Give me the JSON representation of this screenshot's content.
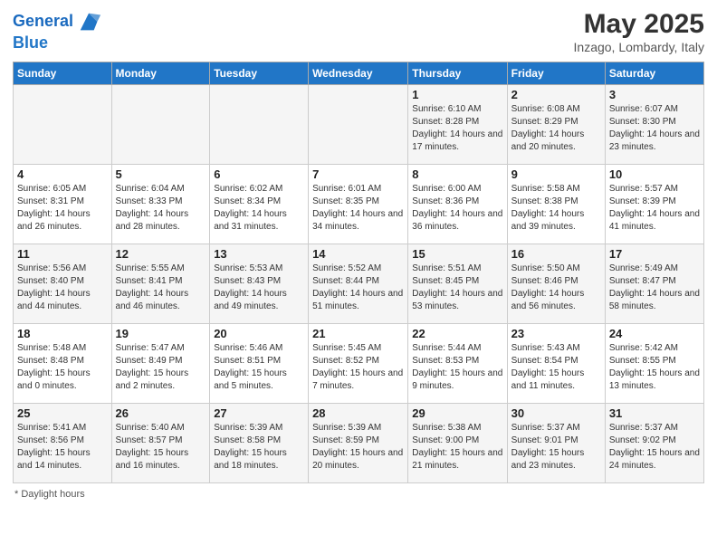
{
  "header": {
    "logo_line1": "General",
    "logo_line2": "Blue",
    "main_title": "May 2025",
    "subtitle": "Inzago, Lombardy, Italy"
  },
  "weekdays": [
    "Sunday",
    "Monday",
    "Tuesday",
    "Wednesday",
    "Thursday",
    "Friday",
    "Saturday"
  ],
  "weeks": [
    [
      {
        "day": "",
        "sunrise": "",
        "sunset": "",
        "daylight": ""
      },
      {
        "day": "",
        "sunrise": "",
        "sunset": "",
        "daylight": ""
      },
      {
        "day": "",
        "sunrise": "",
        "sunset": "",
        "daylight": ""
      },
      {
        "day": "",
        "sunrise": "",
        "sunset": "",
        "daylight": ""
      },
      {
        "day": "1",
        "sunrise": "Sunrise: 6:10 AM",
        "sunset": "Sunset: 8:28 PM",
        "daylight": "Daylight: 14 hours and 17 minutes."
      },
      {
        "day": "2",
        "sunrise": "Sunrise: 6:08 AM",
        "sunset": "Sunset: 8:29 PM",
        "daylight": "Daylight: 14 hours and 20 minutes."
      },
      {
        "day": "3",
        "sunrise": "Sunrise: 6:07 AM",
        "sunset": "Sunset: 8:30 PM",
        "daylight": "Daylight: 14 hours and 23 minutes."
      }
    ],
    [
      {
        "day": "4",
        "sunrise": "Sunrise: 6:05 AM",
        "sunset": "Sunset: 8:31 PM",
        "daylight": "Daylight: 14 hours and 26 minutes."
      },
      {
        "day": "5",
        "sunrise": "Sunrise: 6:04 AM",
        "sunset": "Sunset: 8:33 PM",
        "daylight": "Daylight: 14 hours and 28 minutes."
      },
      {
        "day": "6",
        "sunrise": "Sunrise: 6:02 AM",
        "sunset": "Sunset: 8:34 PM",
        "daylight": "Daylight: 14 hours and 31 minutes."
      },
      {
        "day": "7",
        "sunrise": "Sunrise: 6:01 AM",
        "sunset": "Sunset: 8:35 PM",
        "daylight": "Daylight: 14 hours and 34 minutes."
      },
      {
        "day": "8",
        "sunrise": "Sunrise: 6:00 AM",
        "sunset": "Sunset: 8:36 PM",
        "daylight": "Daylight: 14 hours and 36 minutes."
      },
      {
        "day": "9",
        "sunrise": "Sunrise: 5:58 AM",
        "sunset": "Sunset: 8:38 PM",
        "daylight": "Daylight: 14 hours and 39 minutes."
      },
      {
        "day": "10",
        "sunrise": "Sunrise: 5:57 AM",
        "sunset": "Sunset: 8:39 PM",
        "daylight": "Daylight: 14 hours and 41 minutes."
      }
    ],
    [
      {
        "day": "11",
        "sunrise": "Sunrise: 5:56 AM",
        "sunset": "Sunset: 8:40 PM",
        "daylight": "Daylight: 14 hours and 44 minutes."
      },
      {
        "day": "12",
        "sunrise": "Sunrise: 5:55 AM",
        "sunset": "Sunset: 8:41 PM",
        "daylight": "Daylight: 14 hours and 46 minutes."
      },
      {
        "day": "13",
        "sunrise": "Sunrise: 5:53 AM",
        "sunset": "Sunset: 8:43 PM",
        "daylight": "Daylight: 14 hours and 49 minutes."
      },
      {
        "day": "14",
        "sunrise": "Sunrise: 5:52 AM",
        "sunset": "Sunset: 8:44 PM",
        "daylight": "Daylight: 14 hours and 51 minutes."
      },
      {
        "day": "15",
        "sunrise": "Sunrise: 5:51 AM",
        "sunset": "Sunset: 8:45 PM",
        "daylight": "Daylight: 14 hours and 53 minutes."
      },
      {
        "day": "16",
        "sunrise": "Sunrise: 5:50 AM",
        "sunset": "Sunset: 8:46 PM",
        "daylight": "Daylight: 14 hours and 56 minutes."
      },
      {
        "day": "17",
        "sunrise": "Sunrise: 5:49 AM",
        "sunset": "Sunset: 8:47 PM",
        "daylight": "Daylight: 14 hours and 58 minutes."
      }
    ],
    [
      {
        "day": "18",
        "sunrise": "Sunrise: 5:48 AM",
        "sunset": "Sunset: 8:48 PM",
        "daylight": "Daylight: 15 hours and 0 minutes."
      },
      {
        "day": "19",
        "sunrise": "Sunrise: 5:47 AM",
        "sunset": "Sunset: 8:49 PM",
        "daylight": "Daylight: 15 hours and 2 minutes."
      },
      {
        "day": "20",
        "sunrise": "Sunrise: 5:46 AM",
        "sunset": "Sunset: 8:51 PM",
        "daylight": "Daylight: 15 hours and 5 minutes."
      },
      {
        "day": "21",
        "sunrise": "Sunrise: 5:45 AM",
        "sunset": "Sunset: 8:52 PM",
        "daylight": "Daylight: 15 hours and 7 minutes."
      },
      {
        "day": "22",
        "sunrise": "Sunrise: 5:44 AM",
        "sunset": "Sunset: 8:53 PM",
        "daylight": "Daylight: 15 hours and 9 minutes."
      },
      {
        "day": "23",
        "sunrise": "Sunrise: 5:43 AM",
        "sunset": "Sunset: 8:54 PM",
        "daylight": "Daylight: 15 hours and 11 minutes."
      },
      {
        "day": "24",
        "sunrise": "Sunrise: 5:42 AM",
        "sunset": "Sunset: 8:55 PM",
        "daylight": "Daylight: 15 hours and 13 minutes."
      }
    ],
    [
      {
        "day": "25",
        "sunrise": "Sunrise: 5:41 AM",
        "sunset": "Sunset: 8:56 PM",
        "daylight": "Daylight: 15 hours and 14 minutes."
      },
      {
        "day": "26",
        "sunrise": "Sunrise: 5:40 AM",
        "sunset": "Sunset: 8:57 PM",
        "daylight": "Daylight: 15 hours and 16 minutes."
      },
      {
        "day": "27",
        "sunrise": "Sunrise: 5:39 AM",
        "sunset": "Sunset: 8:58 PM",
        "daylight": "Daylight: 15 hours and 18 minutes."
      },
      {
        "day": "28",
        "sunrise": "Sunrise: 5:39 AM",
        "sunset": "Sunset: 8:59 PM",
        "daylight": "Daylight: 15 hours and 20 minutes."
      },
      {
        "day": "29",
        "sunrise": "Sunrise: 5:38 AM",
        "sunset": "Sunset: 9:00 PM",
        "daylight": "Daylight: 15 hours and 21 minutes."
      },
      {
        "day": "30",
        "sunrise": "Sunrise: 5:37 AM",
        "sunset": "Sunset: 9:01 PM",
        "daylight": "Daylight: 15 hours and 23 minutes."
      },
      {
        "day": "31",
        "sunrise": "Sunrise: 5:37 AM",
        "sunset": "Sunset: 9:02 PM",
        "daylight": "Daylight: 15 hours and 24 minutes."
      }
    ]
  ],
  "footer": {
    "daylight_label": "Daylight hours"
  }
}
